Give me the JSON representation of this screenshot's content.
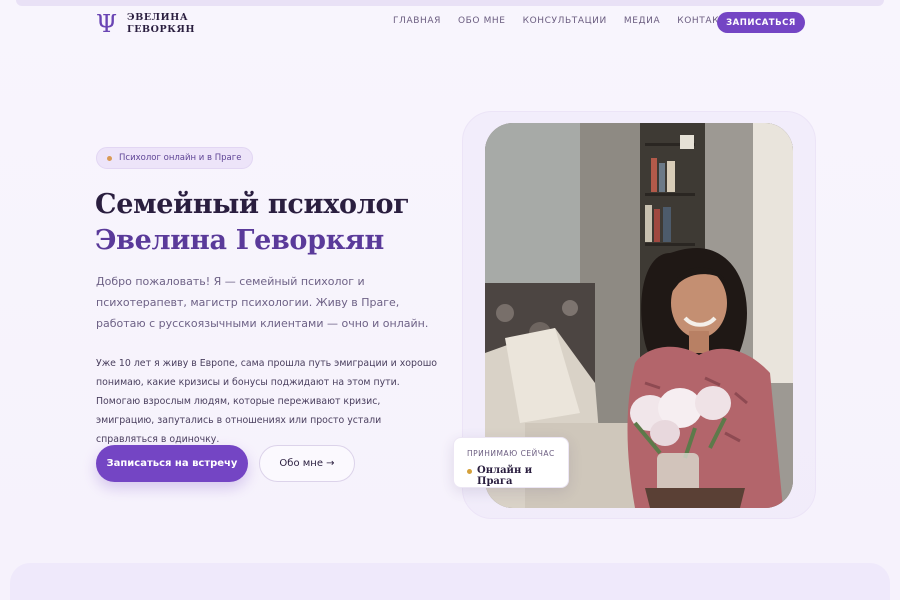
{
  "logo": {
    "symbol": "Ψ",
    "line1": "ЭВЕЛИНА",
    "line2": "ГЕВОРКЯН"
  },
  "nav": {
    "items": [
      "ГЛАВНАЯ",
      "ОБО МНЕ",
      "КОНСУЛЬТАЦИИ",
      "МЕДИА",
      "КОНТАКТЫ"
    ],
    "cta": "ЗАПИСАТЬСЯ"
  },
  "hero": {
    "pill": "Психолог онлайн и в Праге",
    "title_line1": "Семейный психолог",
    "title_line2": "Эвелина Геворкян",
    "lead": "Добро пожаловать! Я — семейный психолог и психотерапевт, магистр психологии. Живу в Праге, работаю с русскоязычными клиентами — очно и онлайн.",
    "body": "Уже 10 лет я живу в Европе, сама прошла путь эмиграции и хорошо понимаю, какие кризисы и бонусы поджидают на этом пути. Помогаю взрослым людям, которые переживают кризис, эмиграцию, запутались в отношениях или просто устали справляться в одиночку.",
    "primary_button": "Записаться на встречу",
    "secondary_button": "Обо мне →"
  },
  "status_card": {
    "label": "ПРИНИМАЮ СЕЙЧАС",
    "value": "Онлайн и Прага"
  },
  "colors": {
    "accent": "#7445c4",
    "heading": "#2a1e3f",
    "accent_title": "#5a3a9a",
    "status_dot": "#d4a03a"
  }
}
